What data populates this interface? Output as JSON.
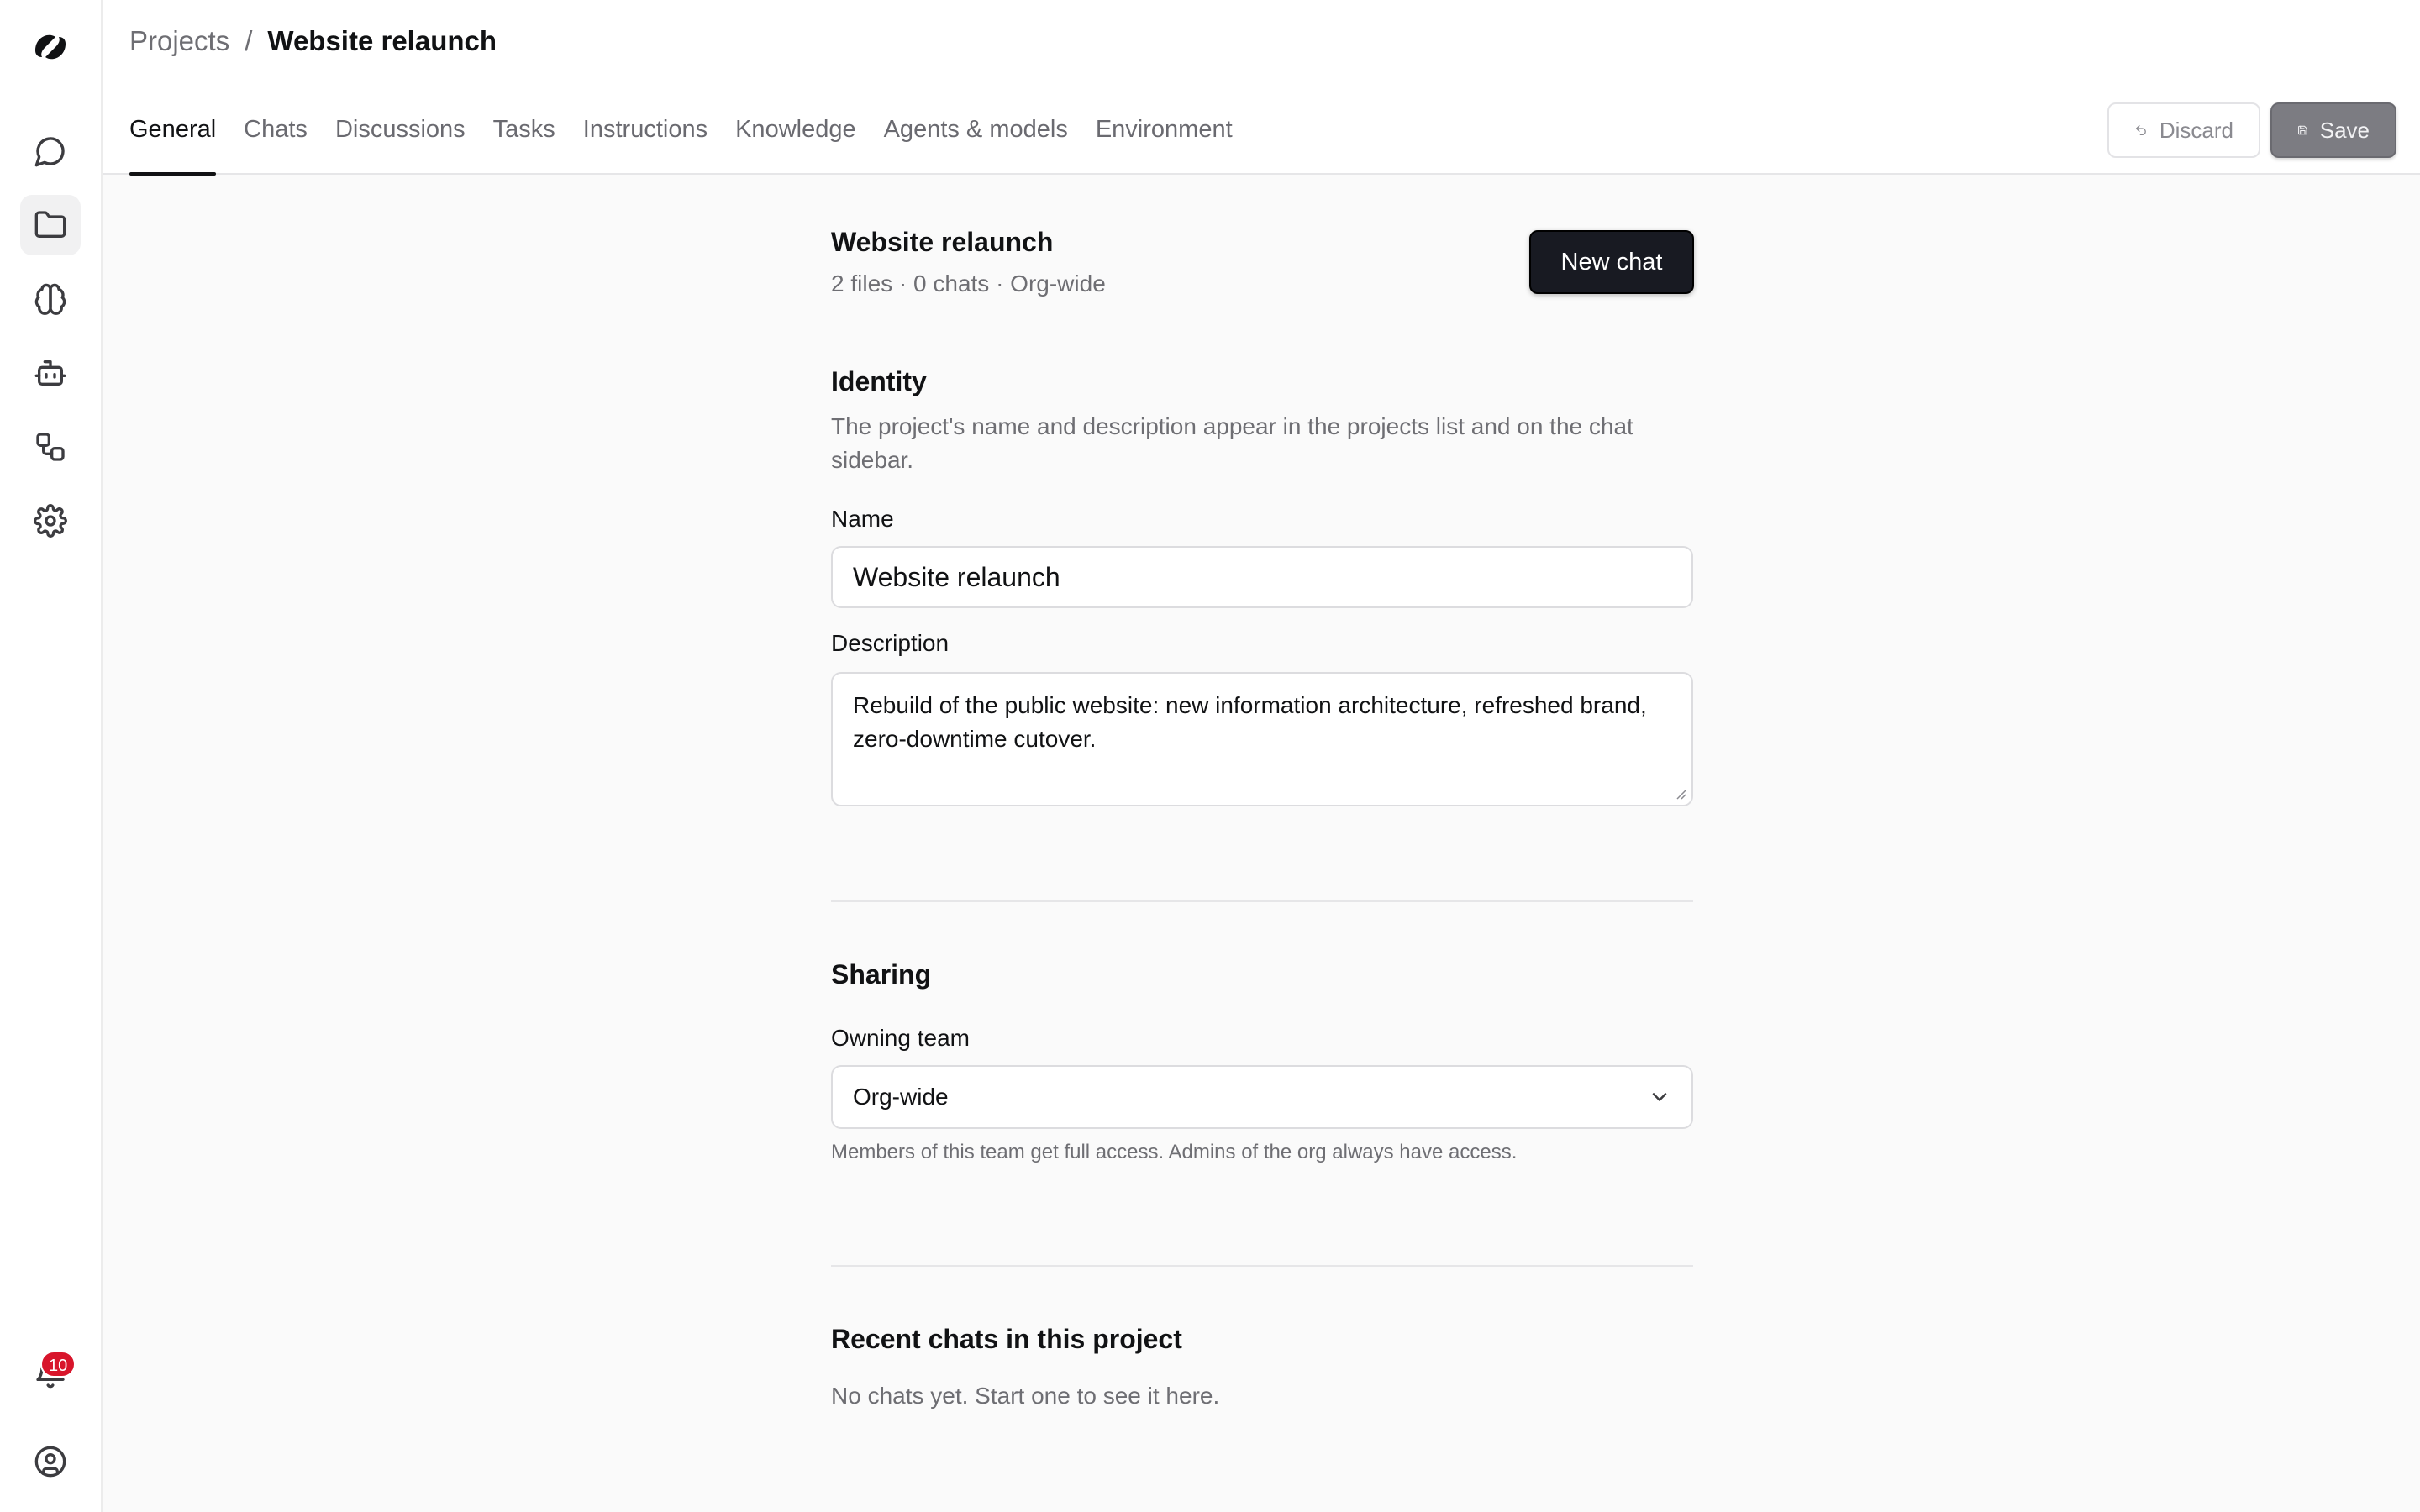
{
  "breadcrumb": {
    "root": "Projects",
    "separator": "/",
    "current": "Website relaunch"
  },
  "tabs": [
    {
      "label": "General",
      "active": true
    },
    {
      "label": "Chats"
    },
    {
      "label": "Discussions"
    },
    {
      "label": "Tasks"
    },
    {
      "label": "Instructions"
    },
    {
      "label": "Knowledge"
    },
    {
      "label": "Agents & models"
    },
    {
      "label": "Environment"
    }
  ],
  "toolbar": {
    "discard_label": "Discard",
    "save_label": "Save"
  },
  "project": {
    "title": "Website relaunch",
    "meta": "2 files · 0 chats · Org-wide",
    "new_chat_label": "New chat"
  },
  "identity": {
    "title": "Identity",
    "description": "The project's name and description appear in the projects list and on the chat sidebar.",
    "name_label": "Name",
    "name_value": "Website relaunch",
    "description_label": "Description",
    "description_value": "Rebuild of the public website: new information architecture, refreshed brand, zero-downtime cutover."
  },
  "sharing": {
    "title": "Sharing",
    "owning_team_label": "Owning team",
    "owning_team_value": "Org-wide",
    "hint": "Members of this team get full access. Admins of the org always have access."
  },
  "recent": {
    "title": "Recent chats in this project",
    "empty": "No chats yet. Start one to see it here."
  },
  "notifications": {
    "count": "10"
  },
  "icons": {
    "rail": [
      "chat-icon",
      "folder-icon",
      "brain-icon",
      "bot-icon",
      "workflow-icon",
      "gear-icon",
      "bell-icon",
      "user-circle-icon"
    ]
  },
  "colors": {
    "accent": "#181a22",
    "badge": "#d8152b",
    "save_button": "#7c7c82"
  }
}
